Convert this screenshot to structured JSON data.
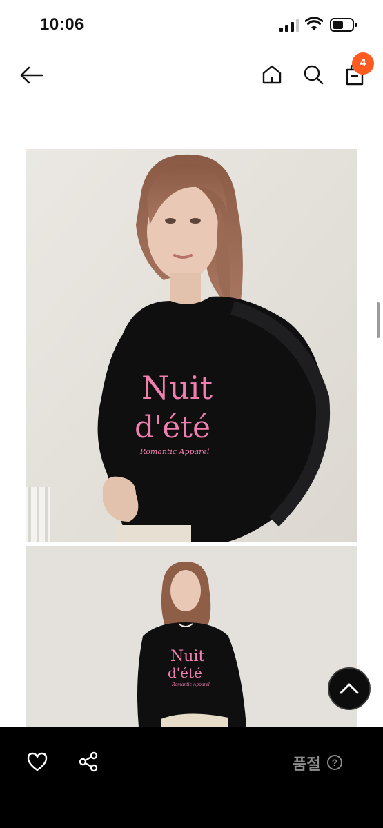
{
  "status_bar": {
    "time": "10:06"
  },
  "header": {
    "cart_count": "4",
    "icons": [
      "back-arrow-icon",
      "home-icon",
      "search-icon",
      "shopping-bag-icon"
    ]
  },
  "product": {
    "shirt_text_line1": "Nuit",
    "shirt_text_line2": "d'été",
    "shirt_brand": "Romantic Apparel"
  },
  "bottom_bar": {
    "status_label": "품절",
    "help_symbol": "?"
  },
  "colors": {
    "badge": "#ff5a1f",
    "bottom_bar_bg": "#000000",
    "disabled_text": "#8e8e8e"
  }
}
